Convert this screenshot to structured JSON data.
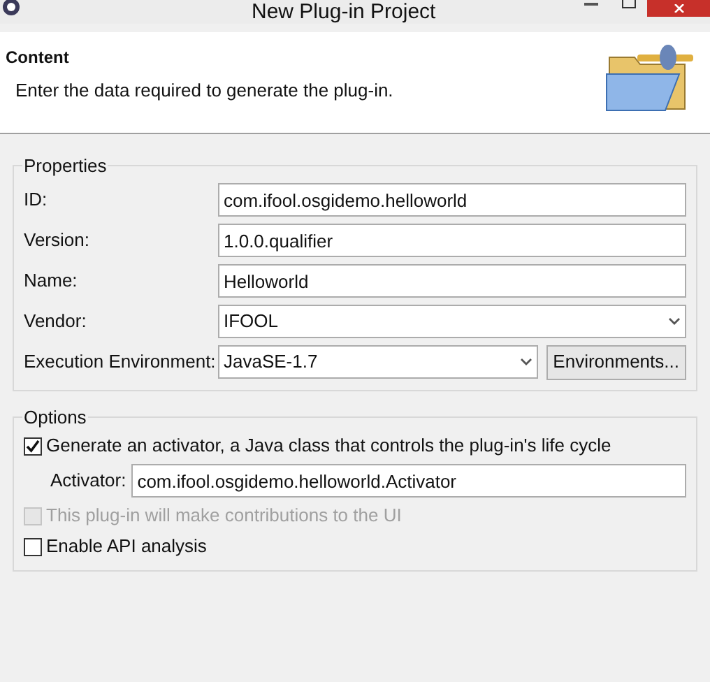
{
  "window": {
    "title": "New Plug-in Project"
  },
  "header": {
    "title": "Content",
    "description": "Enter the data required to generate the plug-in."
  },
  "properties": {
    "legend": "Properties",
    "fields": [
      {
        "kind": "text",
        "label": "ID:",
        "value": "com.ifool.osgidemo.helloworld"
      },
      {
        "kind": "text",
        "label": "Version:",
        "value": "1.0.0.qualifier"
      },
      {
        "kind": "text",
        "label": "Name:",
        "value": "Helloworld"
      },
      {
        "kind": "combo",
        "label": "Vendor:",
        "value": "IFOOL"
      },
      {
        "kind": "combo_button",
        "label": "Execution Environment:",
        "value": "JavaSE-1.7",
        "button": "Environments..."
      }
    ]
  },
  "options": {
    "legend": "Options",
    "generate_activator": {
      "label": "Generate an activator, a Java class that controls the plug-in's life cycle",
      "checked": true,
      "disabled": false
    },
    "activator": {
      "label": "Activator:",
      "value": "com.ifool.osgidemo.helloworld.Activator"
    },
    "ui_contributions": {
      "label": "This plug-in will make contributions to the UI",
      "checked": false,
      "disabled": true
    },
    "api_analysis": {
      "label": "Enable API analysis",
      "checked": false,
      "disabled": false
    }
  }
}
